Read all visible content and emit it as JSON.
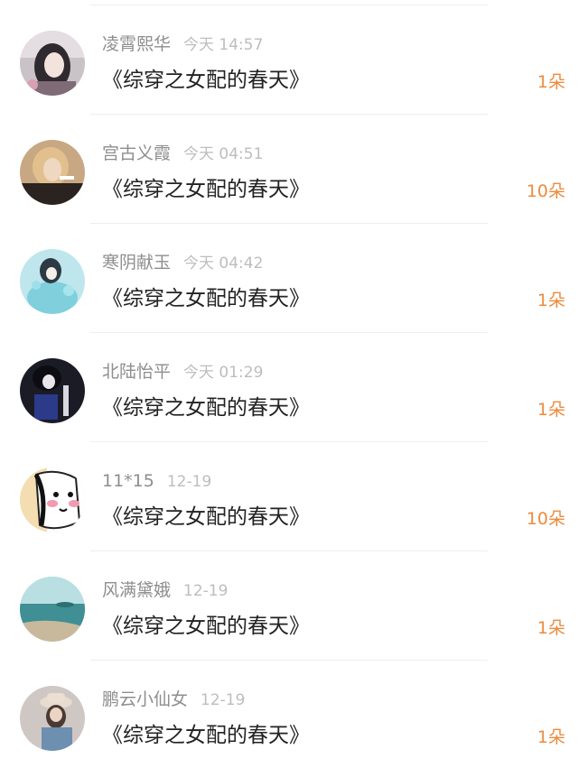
{
  "items": [
    {
      "username": "凌霄熙华",
      "time": "今天 14:57",
      "book": "《综穿之女配的春天》",
      "flowers": "1朵",
      "avatar": "avatar-girl-photo"
    },
    {
      "username": "宫古义霞",
      "time": "今天 04:51",
      "book": "《综穿之女配的春天》",
      "flowers": "10朵",
      "avatar": "avatar-blonde-photo"
    },
    {
      "username": "寒阴献玉",
      "time": "今天 04:42",
      "book": "《综穿之女配的春天》",
      "flowers": "1朵",
      "avatar": "avatar-illustration-blue"
    },
    {
      "username": "北陆怡平",
      "time": "今天 01:29",
      "book": "《综穿之女配的春天》",
      "flowers": "1朵",
      "avatar": "avatar-dark-anime"
    },
    {
      "username": "11*15",
      "time": "12-19",
      "book": "《综穿之女配的春天》",
      "flowers": "10朵",
      "avatar": "avatar-cartoon-sketch"
    },
    {
      "username": "风满黛娥",
      "time": "12-19",
      "book": "《综穿之女配的春天》",
      "flowers": "1朵",
      "avatar": "avatar-seascape"
    },
    {
      "username": "鹏云小仙女",
      "time": "12-19",
      "book": "《综穿之女配的春天》",
      "flowers": "1朵",
      "avatar": "avatar-hat-girl"
    }
  ],
  "colors": {
    "accent": "#ec8b3e",
    "username": "#8e8e8e",
    "time": "#bdbdbd",
    "title": "#222222",
    "divider": "#eeeeee"
  }
}
